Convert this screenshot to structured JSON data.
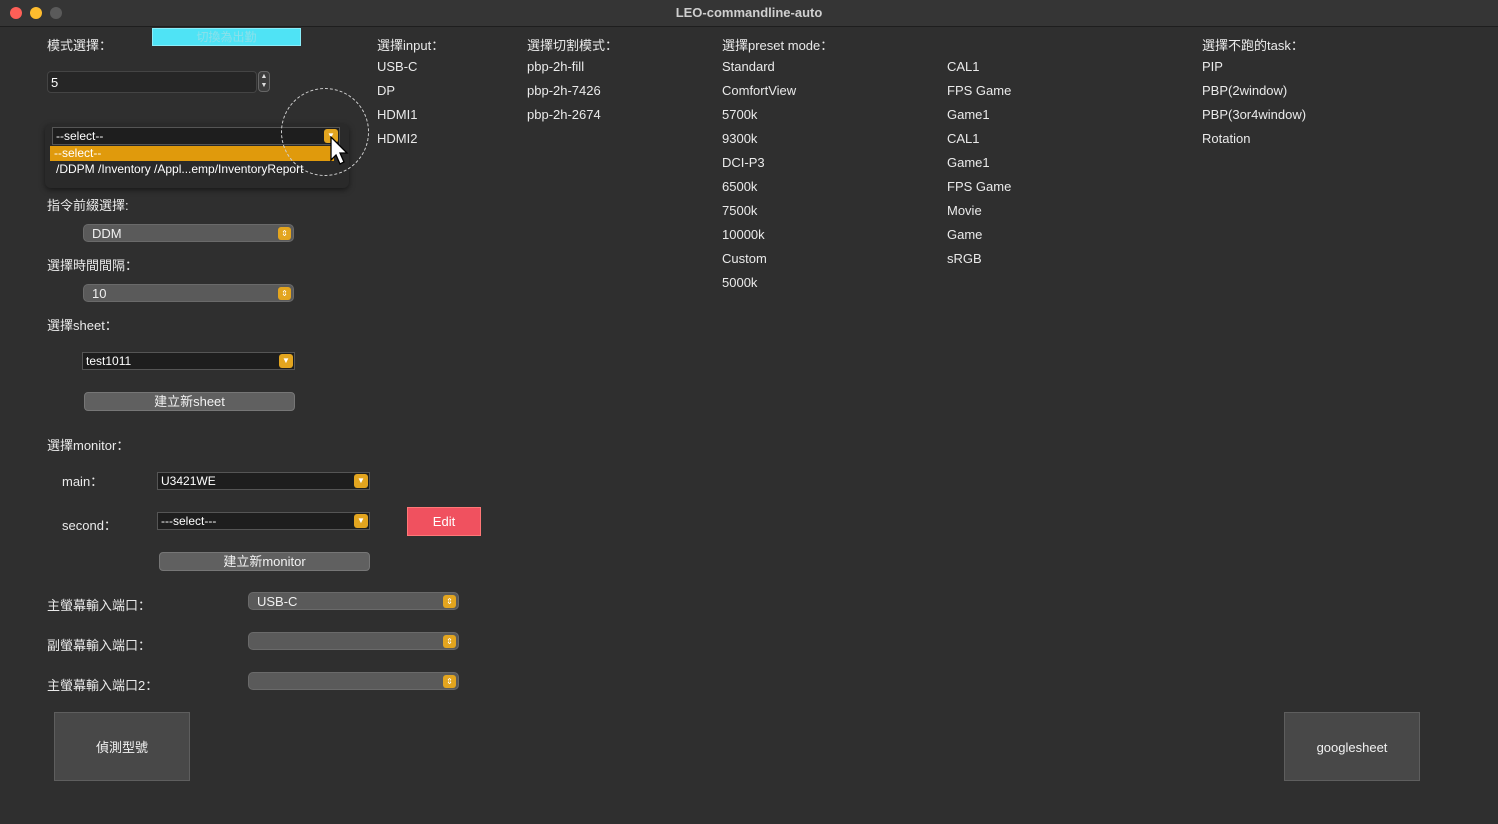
{
  "window": {
    "title": "LEO-commandline-auto"
  },
  "left": {
    "mode_label": "模式選擇：",
    "mode_button": "切換為出勤",
    "number_value": "5",
    "file_combo": {
      "value": "--select--",
      "options": [
        "--select--",
        "/DDPM /Inventory /Appl...emp/InventoryReport"
      ]
    },
    "prefix_label": "指令前綴選擇:",
    "prefix_value": "DDM",
    "interval_label": "選擇時間間隔：",
    "interval_value": "10",
    "sheet_label": "選擇sheet：",
    "sheet_value": "test1011",
    "new_sheet_button": "建立新sheet",
    "monitor_label": "選擇monitor：",
    "main_label": "main：",
    "main_value": "U3421WE",
    "second_label": "second：",
    "second_value": "---select---",
    "edit_button": "Edit",
    "new_monitor_button": "建立新monitor",
    "main_port_label": "主螢幕輸入端口：",
    "main_port_value": "USB-C",
    "sub_port_label": "副螢幕輸入端口：",
    "sub_port_value": "",
    "main_port2_label": "主螢幕輸入端口2：",
    "main_port2_value": "",
    "detect_button": "偵測型號",
    "googlesheet_button": "googlesheet"
  },
  "input_col": {
    "header": "選擇input：",
    "items": [
      "USB-C",
      "DP",
      "HDMI1",
      "HDMI2"
    ]
  },
  "split_col": {
    "header": "選擇切割模式：",
    "items": [
      "pbp-2h-fill",
      "pbp-2h-7426",
      "pbp-2h-2674"
    ]
  },
  "preset_col": {
    "header": "選擇preset mode：",
    "items": [
      "Standard",
      "ComfortView",
      "5700k",
      "9300k",
      "DCI-P3",
      "6500k",
      "7500k",
      "10000k",
      "Custom",
      "5000k"
    ],
    "items2": [
      "CAL1",
      "FPS Game",
      "Game1",
      "CAL1",
      "Game1",
      "FPS Game",
      "Movie",
      "Game",
      "sRGB"
    ]
  },
  "task_col": {
    "header": "選擇不跑的task：",
    "items": [
      "PIP",
      "PBP(2window)",
      "PBP(3or4window)",
      "Rotation"
    ]
  },
  "colors": {
    "accent": "#e3a51f",
    "cyan_button": "#4fe3f5",
    "edit_red": "#f0515f",
    "highlight": "#e09a0c"
  }
}
